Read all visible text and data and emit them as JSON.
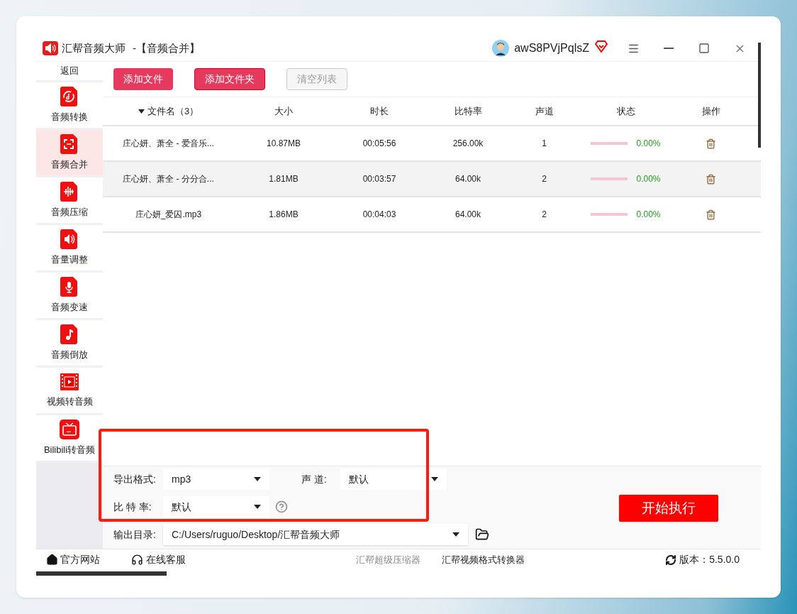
{
  "window": {
    "app_name": "汇帮音频大师",
    "subtitle": "-【音频合并】",
    "username": "awS8PVjPqlsZ"
  },
  "sidebar": {
    "back": "返回",
    "items": [
      {
        "label": "音频转换",
        "selected": false
      },
      {
        "label": "音频合并",
        "selected": true
      },
      {
        "label": "音频压缩",
        "selected": false
      },
      {
        "label": "音量调整",
        "selected": false
      },
      {
        "label": "音频变速",
        "selected": false
      },
      {
        "label": "音频倒放",
        "selected": false
      },
      {
        "label": "视频转音频",
        "selected": false
      },
      {
        "label": "Bilibili转音频",
        "selected": false
      }
    ]
  },
  "toolbar": [
    {
      "label": "添加文件",
      "disabled": false,
      "focused": false
    },
    {
      "label": "添加文件夹",
      "disabled": false,
      "focused": true
    },
    {
      "label": "清空列表",
      "disabled": true,
      "focused": false
    }
  ],
  "table": {
    "columns": [
      "文件名（3）",
      "大小",
      "时长",
      "比特率",
      "声道",
      "状态",
      "操作"
    ],
    "rows": [
      {
        "name": "庄心妍、萧全 - 爱音乐...",
        "size": "10.87MB",
        "duration": "00:05:56",
        "bitrate": "256.00k",
        "channels": "1",
        "level": 0,
        "progress": "0.00%",
        "selected": false
      },
      {
        "name": "庄心妍、萧全 - 分分合...",
        "size": "1.81MB",
        "duration": "00:03:57",
        "bitrate": "64.00k",
        "channels": "2",
        "level": 0,
        "progress": "0.00%",
        "selected": true
      },
      {
        "name": "庄心妍_爱囚.mp3",
        "size": "1.86MB",
        "duration": "00:04:03",
        "bitrate": "64.00k",
        "channels": "2",
        "level": 0,
        "progress": "0.00%",
        "selected": false
      }
    ]
  },
  "settings": {
    "format": {
      "label": "导出格式:",
      "value": "mp3"
    },
    "channel": {
      "label": "声 道:",
      "value": "默认"
    },
    "bitrate": {
      "label": "比 特 率:",
      "value": "默认"
    },
    "output_dir": {
      "label": "输出目录:",
      "value": "C:/Users/ruguo/Desktop/汇帮音频大师"
    },
    "start_button": "开始执行"
  },
  "footer": {
    "links": [
      "官方网站",
      "在线客服"
    ],
    "products": [
      "汇帮超级压缩器",
      "汇帮视频格式转换器"
    ],
    "version": "版本：5.5.0.0"
  }
}
